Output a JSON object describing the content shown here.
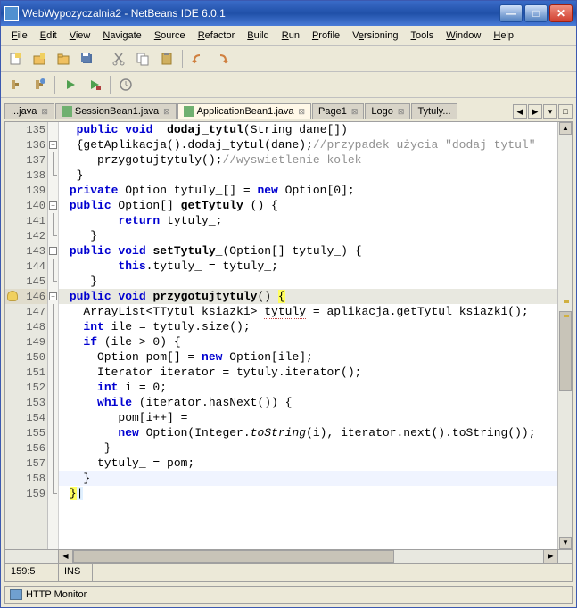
{
  "window": {
    "title": "WebWypozyczalnia2 - NetBeans IDE 6.0.1"
  },
  "menu": {
    "file": "File",
    "edit": "Edit",
    "view": "View",
    "navigate": "Navigate",
    "source": "Source",
    "refactor": "Refactor",
    "build": "Build",
    "run": "Run",
    "profile": "Profile",
    "versioning": "Versioning",
    "tools": "Tools",
    "window": "Window",
    "help": "Help"
  },
  "tabs": {
    "overflow": "...java",
    "session": "SessionBean1.java",
    "app": "ApplicationBean1.java",
    "page1": "Page1",
    "logo": "Logo",
    "tytuly": "Tytuly..."
  },
  "code": {
    "lines": [
      {
        "n": 135,
        "fold": "",
        "html": "  <span class='kw'>public</span> <span class='kw'>void</span>  <span class='ident-bold'>dodaj_tytul</span>(String dane[])"
      },
      {
        "n": 136,
        "fold": "-",
        "html": "  {getAplikacja().dodaj_tytul(dane);<span class='comment'>//przypadek użycia \"dodaj tytul\"</span>"
      },
      {
        "n": 137,
        "fold": "|",
        "html": "     przygotujtytuly();<span class='comment'>//wyswietlenie kolek</span>"
      },
      {
        "n": 138,
        "fold": "L",
        "html": "  }"
      },
      {
        "n": 139,
        "fold": "",
        "html": " <span class='kw'>private</span> Option tytuly_[] = <span class='kw'>new</span> Option[0];"
      },
      {
        "n": 140,
        "fold": "-",
        "html": " <span class='kw'>public</span> Option[] <span class='ident-bold'>getTytuly_</span>() {"
      },
      {
        "n": 141,
        "fold": "|",
        "html": "        <span class='kw'>return</span> tytuly_;"
      },
      {
        "n": 142,
        "fold": "L",
        "html": "    }"
      },
      {
        "n": 143,
        "fold": "-",
        "html": " <span class='kw'>public</span> <span class='kw'>void</span> <span class='ident-bold'>setTytuly_</span>(Option[] tytuly_) {"
      },
      {
        "n": 144,
        "fold": "|",
        "html": "        <span class='kw'>this</span>.tytuly_ = tytuly_;"
      },
      {
        "n": 145,
        "fold": "L",
        "html": "    }"
      },
      {
        "n": 146,
        "fold": "-",
        "html": " <span class='kw'>public</span> <span class='kw'>void</span> <span class='ident-bold'>przygotujtytuly</span>() <span class='brace-match'>{</span>",
        "bulb": true,
        "hl": true
      },
      {
        "n": 147,
        "fold": "|",
        "html": "   ArrayList&lt;TTytul_ksiazki&gt; <span class='err-underline'>tytuly</span> = aplikacja.getTytul_ksiazki();"
      },
      {
        "n": 148,
        "fold": "|",
        "html": "   <span class='kw'>int</span> ile = tytuly.size();"
      },
      {
        "n": 149,
        "fold": "|",
        "html": "   <span class='kw'>if</span> (ile &gt; 0) {"
      },
      {
        "n": 150,
        "fold": "|",
        "html": "     Option pom[] = <span class='kw'>new</span> Option[ile];"
      },
      {
        "n": 151,
        "fold": "|",
        "html": "     Iterator iterator = tytuly.iterator();"
      },
      {
        "n": 152,
        "fold": "|",
        "html": "     <span class='kw'>int</span> i = 0;"
      },
      {
        "n": 153,
        "fold": "|",
        "html": "     <span class='kw'>while</span> (iterator.hasNext()) {"
      },
      {
        "n": 154,
        "fold": "|",
        "html": "        pom[i++] ="
      },
      {
        "n": 155,
        "fold": "|",
        "html": "        <span class='kw'>new</span> Option(Integer.<span class='method-call'>toString</span>(i), iterator.next().toString());"
      },
      {
        "n": 156,
        "fold": "|",
        "html": "      }"
      },
      {
        "n": 157,
        "fold": "|",
        "html": "     tytuly_ = pom;"
      },
      {
        "n": 158,
        "fold": "|",
        "html": "   }",
        "current": true
      },
      {
        "n": 159,
        "fold": "L",
        "html": " <span class='brace-match'>}</span><span class='cursor-brace'>|</span>"
      }
    ]
  },
  "status": {
    "pos": "159:5",
    "ins": "INS"
  },
  "bottom": {
    "monitor": "HTTP Monitor"
  }
}
